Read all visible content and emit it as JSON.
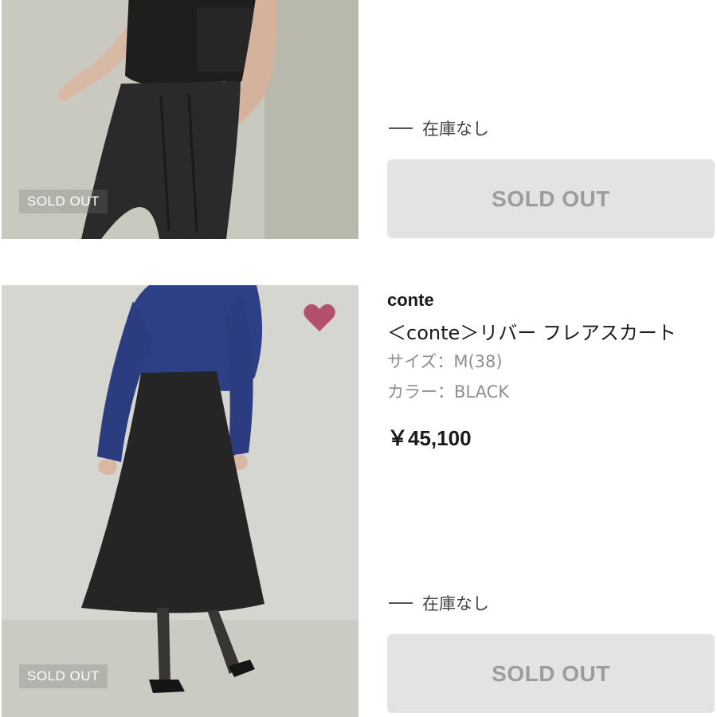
{
  "items": [
    {
      "badge": "SOLD OUT",
      "stock_status": "在庫なし",
      "button_label": "SOLD OUT"
    },
    {
      "badge": "SOLD OUT",
      "brand": "conte",
      "name": "＜conte＞リバー フレアスカート",
      "size_label": "サイズ：M(38)",
      "color_label": "カラー：BLACK",
      "price": "￥45,100",
      "favorite_icon": "heart-icon",
      "favorite_color": "#b3506e",
      "stock_status": "在庫なし",
      "button_label": "SOLD OUT"
    }
  ]
}
